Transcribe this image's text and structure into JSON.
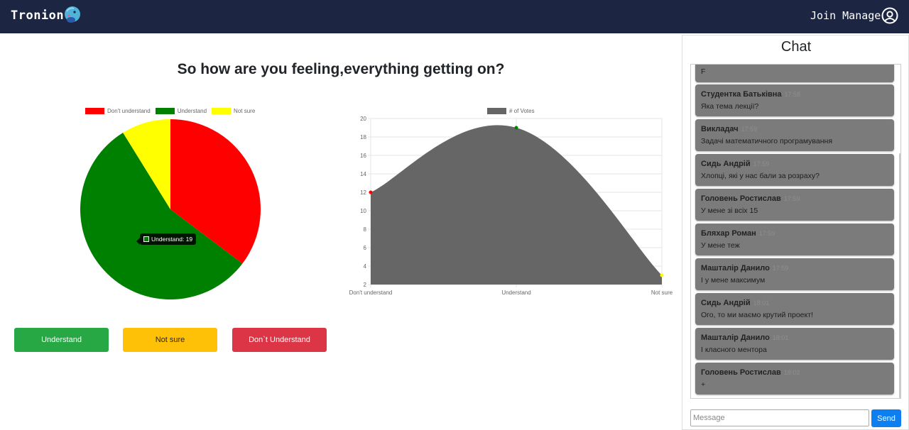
{
  "nav": {
    "brand": "Tronion",
    "join_manage": "Join Manage",
    "bg_color": "#1c2541"
  },
  "question": "So how are you feeling,everything getting on?",
  "pie_legend": [
    {
      "label": "Don't understand",
      "color": "#ff0000"
    },
    {
      "label": "Understand",
      "color": "#008000"
    },
    {
      "label": "Not sure",
      "color": "#ffff00"
    }
  ],
  "area_legend": {
    "label": "# of Votes",
    "color": "#666666"
  },
  "tooltip": {
    "label": "Understand: 19"
  },
  "chart_data": [
    {
      "type": "pie",
      "categories": [
        "Don't understand",
        "Understand",
        "Not sure"
      ],
      "values": [
        12,
        19,
        3
      ],
      "colors": [
        "#ff0000",
        "#008000",
        "#ffff00"
      ],
      "legend": "top"
    },
    {
      "type": "area",
      "categories": [
        "Don't understand",
        "Understand",
        "Not sure"
      ],
      "series": [
        {
          "name": "# of Votes",
          "values": [
            12,
            19,
            3
          ],
          "point_colors": [
            "#ff0000",
            "#008000",
            "#ffff00"
          ]
        }
      ],
      "ylim": [
        2,
        20
      ],
      "yticks": [
        2,
        4,
        6,
        8,
        10,
        12,
        14,
        16,
        18,
        20
      ],
      "fill_color": "#666666",
      "grid": true,
      "legend": "top"
    }
  ],
  "buttons": {
    "understand": "Understand",
    "not_sure": "Not sure",
    "dont_understand": "Don`t Understand"
  },
  "chat": {
    "title": "Chat",
    "first_text": "F",
    "messages": [
      {
        "author": "Студентка Батьківна",
        "time": "17:58",
        "text": "Яка тема лекції?"
      },
      {
        "author": "Викладач",
        "time": "17:59",
        "text": "Задачі математичного програмування"
      },
      {
        "author": "Сидь Андрій",
        "time": "17:59",
        "text": "Хлопці, які у нас бали за розраху?"
      },
      {
        "author": "Головень Ростислав",
        "time": "17:59",
        "text": "У мене зі всіх 15"
      },
      {
        "author": "Бляхар Роман",
        "time": "17:59",
        "text": "У мене теж"
      },
      {
        "author": "Машталір Данило",
        "time": "17:59",
        "text": "І у мене максимум"
      },
      {
        "author": "Сидь Андрій",
        "time": "18:01",
        "text": "Ого, то ми маємо крутий проект!"
      },
      {
        "author": "Машталір Данило",
        "time": "18:01",
        "text": "І класного ментора"
      },
      {
        "author": "Головень Ростислав",
        "time": "18:02",
        "text": "+"
      }
    ],
    "input_placeholder": "Message",
    "send": "Send"
  }
}
